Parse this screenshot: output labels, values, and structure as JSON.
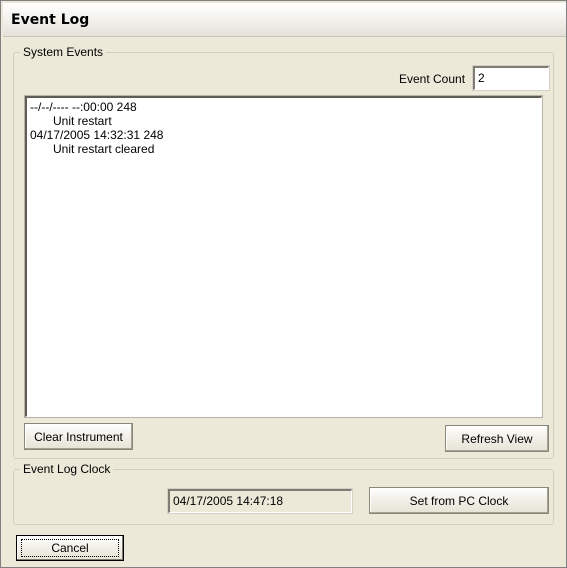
{
  "window": {
    "title": "Event Log"
  },
  "system_events": {
    "legend": "System Events",
    "event_count_label": "Event Count",
    "event_count_value": "2",
    "events": [
      {
        "header": "--/--/---- --:00:00 248",
        "description": "Unit restart"
      },
      {
        "header": "04/17/2005 14:32:31 248",
        "description": "Unit restart cleared"
      }
    ],
    "clear_instrument_label": "Clear Instrument",
    "refresh_view_label": "Refresh View"
  },
  "event_log_clock": {
    "legend": "Event Log Clock",
    "clock_value": "04/17/2005 14:47:18",
    "set_from_pc_clock_label": "Set from PC Clock"
  },
  "footer": {
    "cancel_label": "Cancel"
  }
}
